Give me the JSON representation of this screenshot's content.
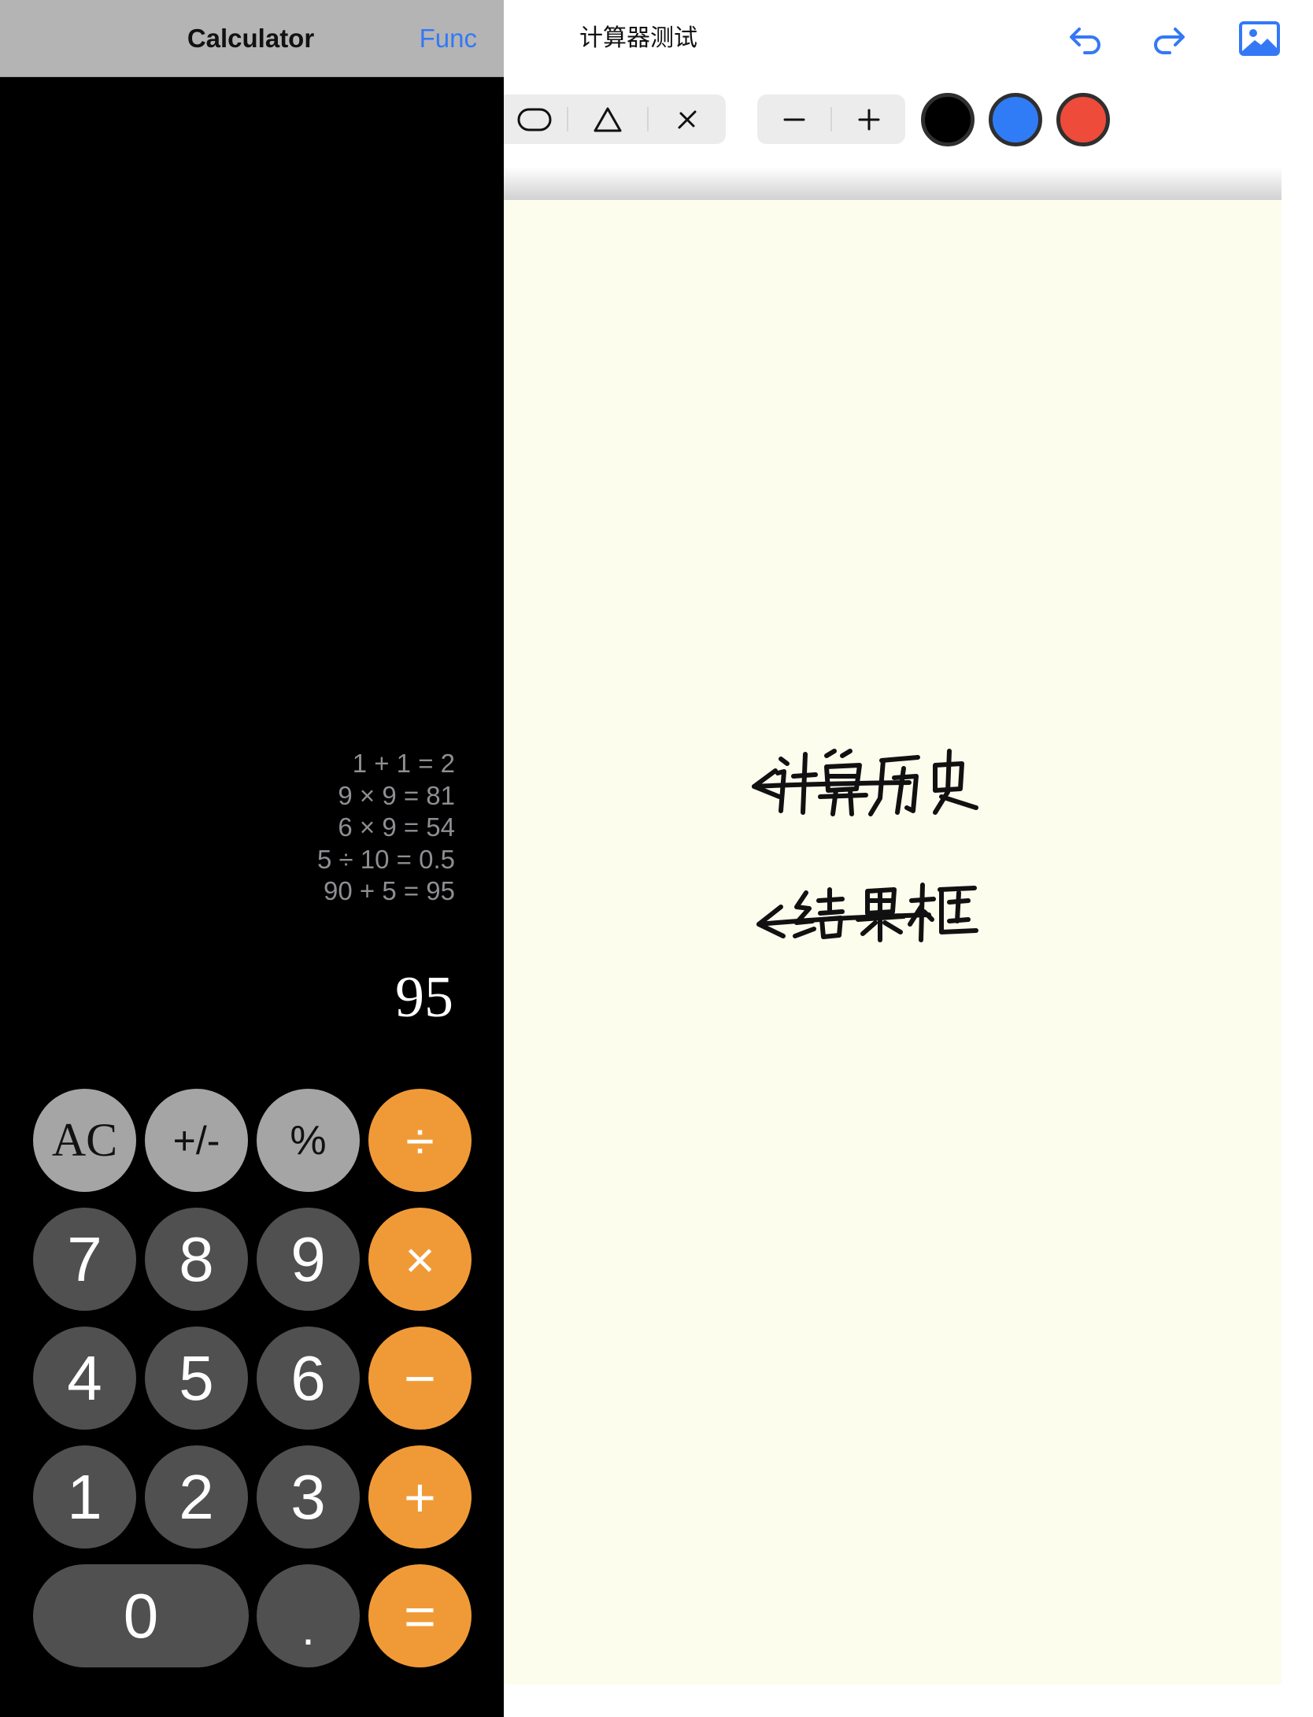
{
  "calculator": {
    "title": "Calculator",
    "func_label": "Func",
    "history": [
      "1 + 1 = 2",
      "9 × 9 = 81",
      "6 × 9 = 54",
      "5 ÷ 10 = 0.5",
      "90 + 5 = 95"
    ],
    "result": "95",
    "keys": {
      "ac": "AC",
      "sign": "+/-",
      "percent": "%",
      "divide": "÷",
      "seven": "7",
      "eight": "8",
      "nine": "9",
      "multiply": "×",
      "four": "4",
      "five": "5",
      "six": "6",
      "minus": "−",
      "one": "1",
      "two": "2",
      "three": "3",
      "plus": "+",
      "zero": "0",
      "decimal": ".",
      "equals": "="
    },
    "colors": {
      "function_key": "#a5a5a5",
      "digit_key": "#505050",
      "operator_key": "#f09a37",
      "accent": "#3478f6"
    }
  },
  "notes": {
    "title": "计算器测试",
    "header_icons": [
      "undo-icon",
      "redo-icon",
      "image-icon"
    ],
    "tools": [
      "rounded-rectangle-icon",
      "triangle-icon",
      "line-icon"
    ],
    "size_controls": [
      "minus-icon",
      "plus-icon"
    ],
    "pen_colors": [
      "#000000",
      "#2f7cf6",
      "#ee4b3a"
    ],
    "paper_color": "#fdfdee",
    "annotations": [
      {
        "text": "计算历史",
        "icon": "arrow-left-icon"
      },
      {
        "text": "结果框",
        "icon": "arrow-left-icon"
      }
    ]
  }
}
